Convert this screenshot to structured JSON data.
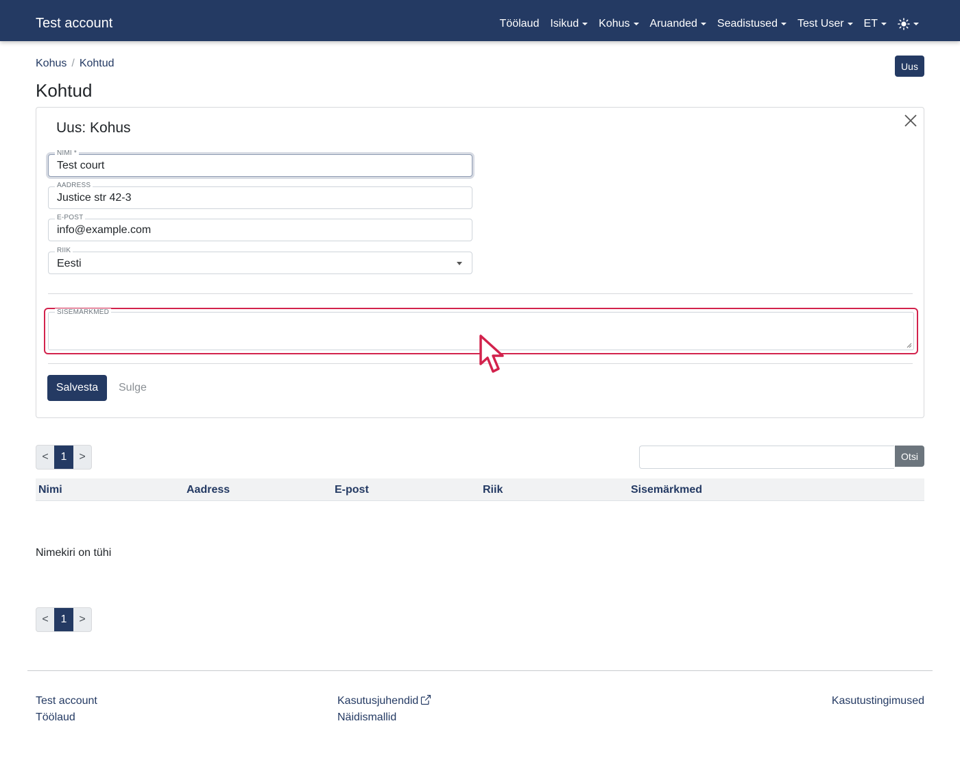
{
  "navbar": {
    "brand": "Test account",
    "items": [
      {
        "label": "Töölaud",
        "dropdown": false
      },
      {
        "label": "Isikud",
        "dropdown": true
      },
      {
        "label": "Kohus",
        "dropdown": true
      },
      {
        "label": "Aruanded",
        "dropdown": true
      },
      {
        "label": "Seadistused",
        "dropdown": true
      },
      {
        "label": "Test User",
        "dropdown": true
      },
      {
        "label": "ET",
        "dropdown": true
      }
    ],
    "theme_icon": "sun-icon"
  },
  "breadcrumb": {
    "items": [
      "Kohus",
      "Kohtud"
    ],
    "separator": "/"
  },
  "header": {
    "new_button": "Uus",
    "title": "Kohtud"
  },
  "form": {
    "title": "Uus: Kohus",
    "close_icon": "close-icon",
    "fields": {
      "name": {
        "label": "NIMI *",
        "value": "Test court"
      },
      "address": {
        "label": "AADRESS",
        "value": "Justice str 42-3"
      },
      "email": {
        "label": "E-POST",
        "value": "info@example.com"
      },
      "country": {
        "label": "RIIK",
        "value": "Eesti"
      },
      "notes": {
        "label": "SISEMÄRKMED",
        "value": ""
      }
    },
    "save_label": "Salvesta",
    "close_label": "Sulge"
  },
  "pagination": {
    "prev": "<",
    "current": "1",
    "next": ">"
  },
  "search": {
    "button": "Otsi",
    "value": ""
  },
  "table": {
    "columns": [
      "Nimi",
      "Aadress",
      "E-post",
      "Riik",
      "Sisemärkmed"
    ],
    "empty_message": "Nimekiri on tühi"
  },
  "footer": {
    "col1": [
      "Test account",
      "Töölaud"
    ],
    "col2": [
      "Kasutusjuhendid",
      "Näidismallid"
    ],
    "col2_external_icon": "external-link-icon",
    "col3": [
      "Kasutustingimused"
    ]
  },
  "colors": {
    "primary": "#243a63",
    "highlight": "#d2224c",
    "secondary": "#6c757d"
  }
}
